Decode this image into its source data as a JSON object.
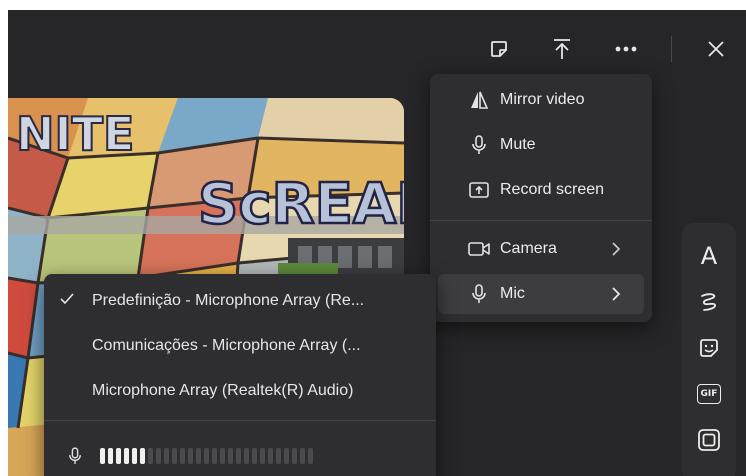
{
  "toolbar": {
    "sticker_icon": "sticker-icon",
    "share_icon": "share-upload-icon",
    "more_icon": "more-horizontal-icon",
    "close_icon": "close-icon"
  },
  "preview": {
    "mural_text": [
      "NITE",
      "ScREAI"
    ]
  },
  "camera_menu": {
    "items": [
      {
        "label": "Mirror video",
        "icon": "mirror-icon"
      },
      {
        "label": "Mute",
        "icon": "microphone-icon"
      },
      {
        "label": "Record screen",
        "icon": "record-screen-icon"
      },
      {
        "label": "Camera",
        "icon": "camera-icon",
        "submenu": true
      },
      {
        "label": "Mic",
        "icon": "microphone-icon",
        "submenu": true,
        "highlighted": true
      }
    ]
  },
  "mic_menu": {
    "devices": [
      {
        "label": "Predefinição - Microphone Array (Re...",
        "selected": true
      },
      {
        "label": "Comunicações - Microphone Array (...",
        "selected": false
      },
      {
        "label": "Microphone Array (Realtek(R) Audio)",
        "selected": false
      }
    ],
    "level_active_bars": 6,
    "level_total_bars": 27
  },
  "side_toolbar": {
    "items": [
      {
        "icon": "text-icon",
        "label": "A"
      },
      {
        "icon": "pen-icon"
      },
      {
        "icon": "sticker-icon"
      },
      {
        "icon": "gif-icon",
        "label": "GIF"
      },
      {
        "icon": "frame-icon"
      }
    ]
  }
}
